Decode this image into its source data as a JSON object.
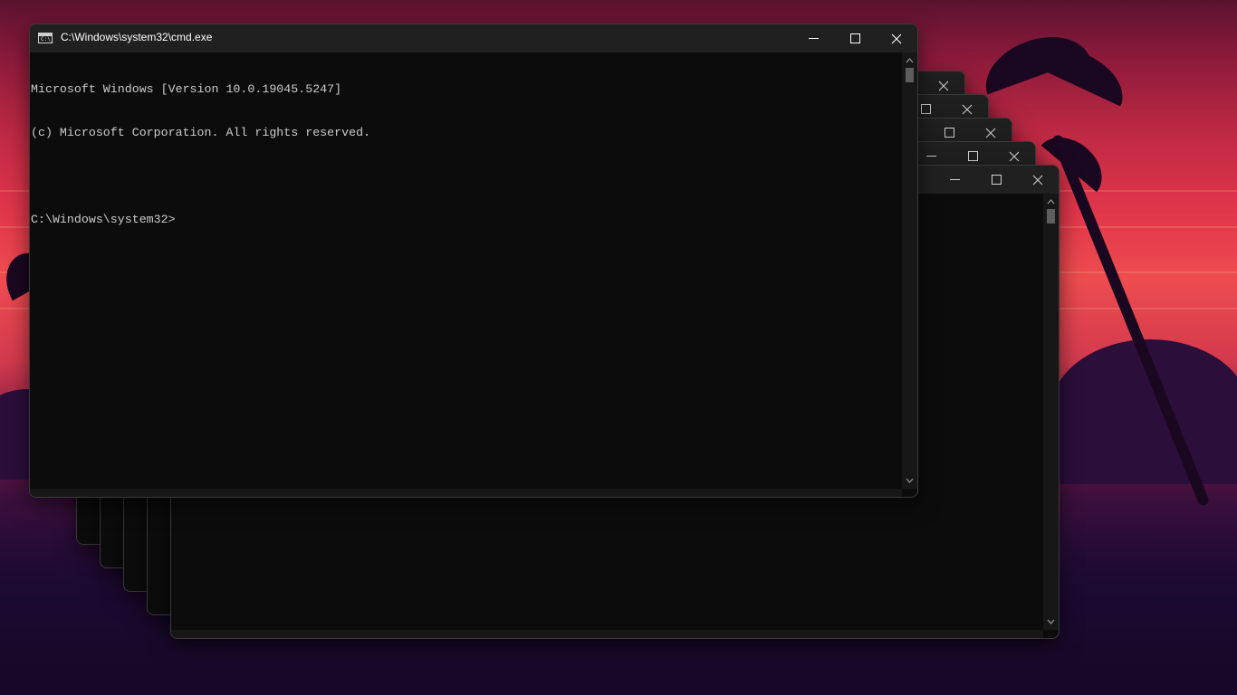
{
  "window": {
    "title": "C:\\Windows\\system32\\cmd.exe",
    "icon": "cmd-app-icon",
    "icon_text": "C:\\_",
    "console_lines": [
      "Microsoft Windows [Version 10.0.19045.5247]",
      "(c) Microsoft Corporation. All rights reserved.",
      "",
      "C:\\Windows\\system32>"
    ]
  },
  "background_window_count": 5,
  "colors": {
    "console_background": "#0c0c0c",
    "console_text": "#cccccc",
    "titlebar": "#202020",
    "window_border": "#3a3a3a"
  }
}
